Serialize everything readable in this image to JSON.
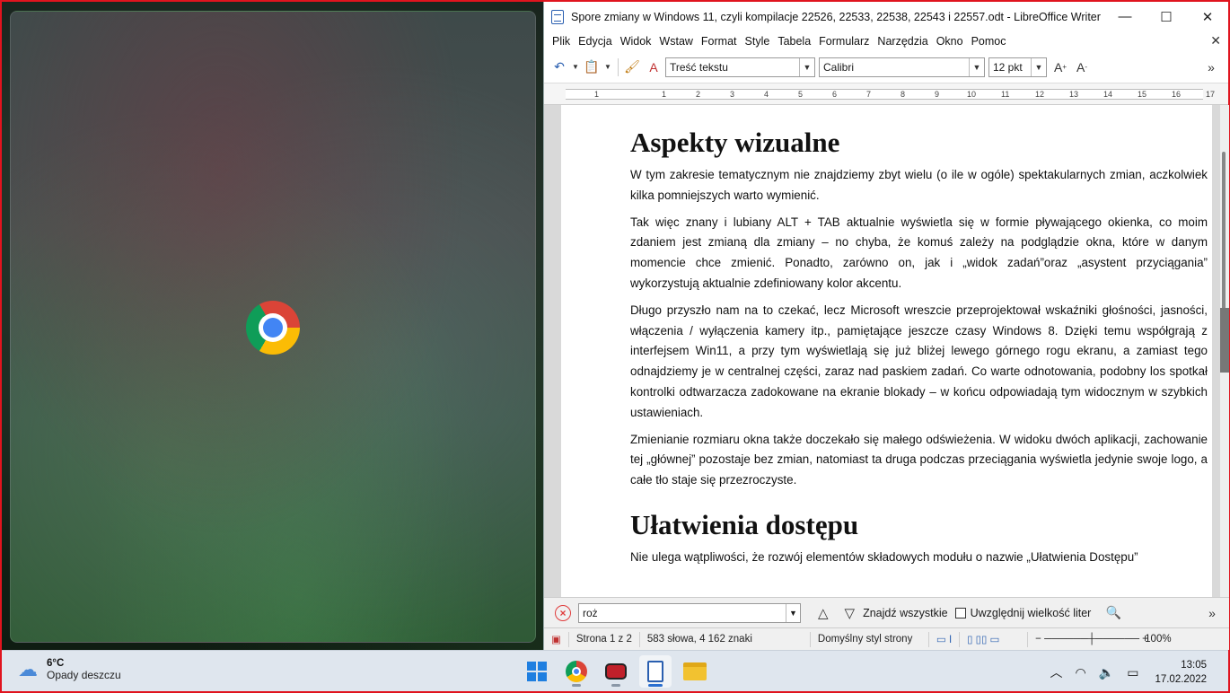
{
  "desktop": {
    "left_app_icon": "chrome-icon"
  },
  "writer": {
    "title": "Spore zmiany w Windows 11, czyli kompilacje 22526, 22533, 22538, 22543 i 22557.odt - LibreOffice Writer",
    "window_controls": {
      "minimize": "—",
      "maximize": "☐",
      "close": "✕"
    },
    "menu": [
      "Plik",
      "Edycja",
      "Widok",
      "Wstaw",
      "Format",
      "Style",
      "Tabela",
      "Formularz",
      "Narzędzia",
      "Okno",
      "Pomoc"
    ],
    "close_doc": "✕",
    "toolbar": {
      "paragraph_style": "Treść tekstu",
      "font_name": "Calibri",
      "font_size": "12 pkt",
      "more": "»"
    },
    "ruler": [
      "1",
      "1",
      "2",
      "3",
      "4",
      "5",
      "6",
      "7",
      "8",
      "9",
      "10",
      "11",
      "12",
      "13",
      "14",
      "15",
      "16",
      "17"
    ],
    "document": {
      "heading1": "Aspekty wizualne",
      "p1": "W tym zakresie tematycznym nie znajdziemy zbyt wielu (o ile w ogóle) spektakularnych zmian, aczkolwiek kilka pomniejszych warto wymienić.",
      "p2": "Tak więc znany i lubiany ALT + TAB aktualnie wyświetla się w formie pływającego okienka, co moim zdaniem jest zmianą dla zmiany – no chyba, że komuś zależy na podglądzie okna, które w danym momencie chce zmienić. Ponadto, zarówno on, jak i „widok zadań”oraz „asystent przyciągania” wykorzystują aktualnie zdefiniowany kolor akcentu.",
      "p3": "Długo przyszło nam na to czekać, lecz Microsoft wreszcie przeprojektował wskaźniki głośności, jasności, włączenia / wyłączenia kamery itp., pamiętające jeszcze czasy Windows 8. Dzięki temu współgrają z interfejsem Win11, a przy tym wyświetlają się już bliżej lewego górnego rogu ekranu, a zamiast tego odnajdziemy je w centralnej części, zaraz nad paskiem zadań. Co warte odnotowania, podobny los spotkał kontrolki odtwarzacza zadokowane na ekranie blokady – w końcu odpowiadają tym widocznym w szybkich ustawieniach.",
      "p4": "Zmienianie rozmiaru okna także doczekało się małego odświeżenia. W widoku dwóch aplikacji, zachowanie tej „głównej” pozostaje bez zmian, natomiast ta druga podczas przeciągania wyświetla jedynie swoje logo, a całe tło staje się przezroczyste.",
      "heading2": "Ułatwienia dostępu",
      "p5": "Nie ulega wątpliwości, że rozwój elementów składowych modułu o nazwie „Ułatwienia Dostępu”"
    },
    "find": {
      "query": "roż",
      "find_all": "Znajdź wszystkie",
      "match_case": "Uwzględnij wielkość liter",
      "more": "»"
    },
    "status": {
      "page": "Strona 1 z 2",
      "words": "583 słowa, 4 162 znaki",
      "page_style": "Domyślny styl strony",
      "zoom": "100%"
    }
  },
  "taskbar": {
    "weather_temp": "6°C",
    "weather_cond": "Opady deszczu",
    "time": "13:05",
    "date": "17.02.2022"
  }
}
